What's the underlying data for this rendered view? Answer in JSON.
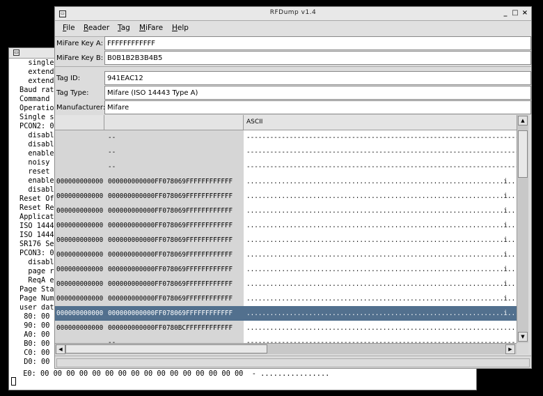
{
  "terminal": {
    "lines": [
      "  single",
      "  extende",
      "  extende",
      "Baud rate",
      "Command (",
      "Operation",
      "Single sh",
      "PCON2: 0C",
      "  disable",
      "  disable",
      "  enable",
      "  noisy e",
      "  reset m",
      "  enable",
      "  disable",
      "Reset Off",
      "Reset Rec",
      "Applicati",
      "ISO 14443",
      "ISO 14443",
      "SR176 Sel",
      "PCON3: 00",
      "  disable",
      "  page re",
      "  ReqA ex",
      "Page Star",
      "Page Numb",
      "user data",
      " 80: 00",
      " 90: 00",
      " A0: 00",
      " B0: 00",
      " C0: 00",
      " D0: 00"
    ],
    "bottom_line": " E0: 00 00 00 00 00 00 00 00 00 00 00 00 00 00 00 00  - ................"
  },
  "window": {
    "title": "RFDump v1.4",
    "buttons": [
      "_",
      "□",
      "×"
    ]
  },
  "menubar": {
    "items": [
      {
        "underline": "F",
        "rest": "ile"
      },
      {
        "underline": "R",
        "rest": "eader"
      },
      {
        "underline": "T",
        "rest": "ag"
      },
      {
        "underline": "M",
        "rest": "iFare"
      },
      {
        "underline": "H",
        "rest": "elp"
      }
    ]
  },
  "fields": {
    "key_a": {
      "label": "MiFare Key A:",
      "value": "FFFFFFFFFFFF"
    },
    "key_b": {
      "label": "MiFare Key B:",
      "value": "B0B1B2B3B4B5"
    },
    "tag_id": {
      "label": "Tag ID:",
      "value": "941EAC12"
    },
    "tag_type": {
      "label": "Tag Type:",
      "value": "Mifare (ISO 14443 Type A)"
    },
    "manufacturer": {
      "label": "Manufacturer:",
      "value": "Mifare"
    }
  },
  "table": {
    "headers": [
      "",
      "",
      "ASCII"
    ],
    "rows": [
      {
        "c1": "",
        "c2": "--",
        "c3": "----------------------------------------------------------------------------------------------------"
      },
      {
        "c1": "",
        "c2": "--",
        "c3": "----------------------------------------------------------------------------------------------------"
      },
      {
        "c1": "",
        "c2": "--",
        "c3": "----------------------------------------------------------------------------------------------------"
      },
      {
        "c1": "000000000000",
        "c2": "000000000000FF078069FFFFFFFFFFFF",
        "c3": "..................................................................i....."
      },
      {
        "c1": "000000000000",
        "c2": "000000000000FF078069FFFFFFFFFFFF",
        "c3": "..................................................................i....."
      },
      {
        "c1": "000000000000",
        "c2": "000000000000FF078069FFFFFFFFFFFF",
        "c3": "..................................................................i....."
      },
      {
        "c1": "000000000000",
        "c2": "000000000000FF078069FFFFFFFFFFFF",
        "c3": "..................................................................i....."
      },
      {
        "c1": "000000000000",
        "c2": "000000000000FF078069FFFFFFFFFFFF",
        "c3": "..................................................................i....."
      },
      {
        "c1": "000000000000",
        "c2": "000000000000FF078069FFFFFFFFFFFF",
        "c3": "..................................................................i....."
      },
      {
        "c1": "000000000000",
        "c2": "000000000000FF078069FFFFFFFFFFFF",
        "c3": "..................................................................i....."
      },
      {
        "c1": "000000000000",
        "c2": "000000000000FF078069FFFFFFFFFFFF",
        "c3": "..................................................................i....."
      },
      {
        "c1": "000000000000",
        "c2": "000000000000FF078069FFFFFFFFFFFF",
        "c3": "..................................................................i....."
      },
      {
        "c1": "000000000000",
        "c2": "000000000000FF078069FFFFFFFFFFFF",
        "c3": "..................................................................i.....",
        "selected": true
      },
      {
        "c1": "000000000000",
        "c2": "000000000000FF0780BCFFFFFFFFFFFF",
        "c3": "....................................................................."
      },
      {
        "c1": "",
        "c2": "--",
        "c3": "----------------------------------------------------------------------------------------------------"
      }
    ]
  },
  "colors": {
    "selection": "#52708e",
    "desktop": "#000000"
  }
}
